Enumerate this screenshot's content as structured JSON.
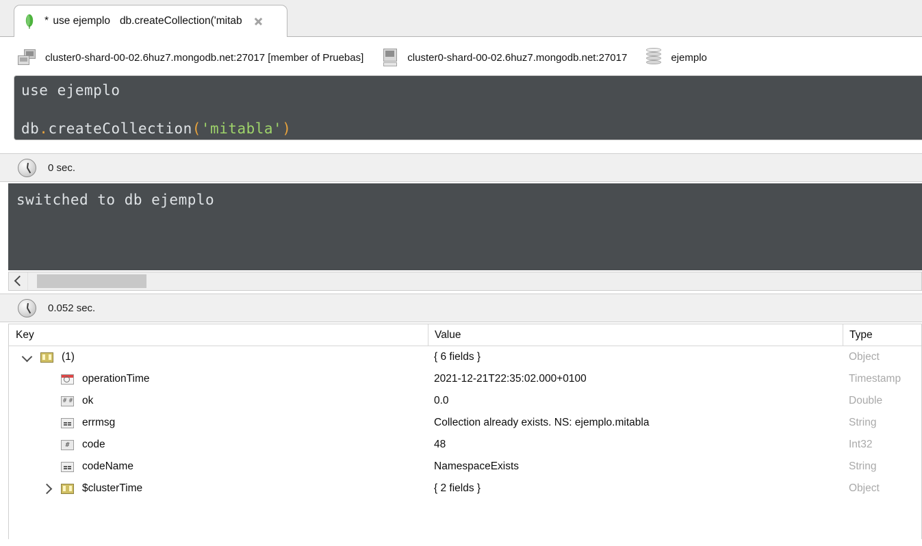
{
  "tab": {
    "leaf_icon": "mongodb-leaf-icon",
    "dirty_marker": "*",
    "title_part1": "use ejemplo",
    "title_part2": "db.createCollection('mitab",
    "close_icon": "close-icon"
  },
  "breadcrumb": [
    {
      "icon": "server-icon",
      "label": "cluster0-shard-00-02.6huz7.mongodb.net:27017 [member of Pruebas]"
    },
    {
      "icon": "monitor-icon",
      "label": "cluster0-shard-00-02.6huz7.mongodb.net:27017"
    },
    {
      "icon": "database-icon",
      "label": "ejemplo"
    }
  ],
  "editor": {
    "line1": "use ejemplo",
    "line2_prefix": "db",
    "line2_dot": ".",
    "line2_fn": "createCollection",
    "line2_open": "(",
    "line2_string": "'mitabla'",
    "line2_close": ")"
  },
  "timing_top": {
    "icon": "clock-icon",
    "text": "0 sec."
  },
  "shell_output": {
    "line1": "switched to db ejemplo"
  },
  "scrollbar": {
    "left_arrow_icon": "chevron-left-icon"
  },
  "timing_bottom": {
    "icon": "clock-icon",
    "text": "0.052 sec."
  },
  "result_table": {
    "columns": [
      "Key",
      "Value",
      "Type"
    ],
    "rows": [
      {
        "indent": 0,
        "twisty": "open",
        "icon": "object-icon",
        "key": "(1)",
        "value": "{ 6 fields }",
        "type": "Object"
      },
      {
        "indent": 1,
        "twisty": "none",
        "icon": "timestamp-icon",
        "key": "operationTime",
        "value": "2021-12-21T22:35:02.000+0100",
        "type": "Timestamp"
      },
      {
        "indent": 1,
        "twisty": "none",
        "icon": "double-icon",
        "key": "ok",
        "value": "0.0",
        "type": "Double"
      },
      {
        "indent": 1,
        "twisty": "none",
        "icon": "string-icon",
        "key": "errmsg",
        "value": "Collection already exists. NS: ejemplo.mitabla",
        "type": "String"
      },
      {
        "indent": 1,
        "twisty": "none",
        "icon": "int32-icon",
        "key": "code",
        "value": "48",
        "type": "Int32"
      },
      {
        "indent": 1,
        "twisty": "none",
        "icon": "string-icon",
        "key": "codeName",
        "value": "NamespaceExists",
        "type": "String"
      },
      {
        "indent": 1,
        "twisty": "closed",
        "icon": "object-icon",
        "key": "$clusterTime",
        "value": "{ 2 fields }",
        "type": "Object"
      }
    ]
  },
  "colors": {
    "editor_bg": "#494d50",
    "editor_text": "#dfe3e6",
    "syntax_punct": "#e8a33d",
    "syntax_string": "#9ed36a",
    "panel_bg": "#f0f0f0",
    "type_text": "#a9a9a9",
    "leaf_green": "#4db33d"
  }
}
